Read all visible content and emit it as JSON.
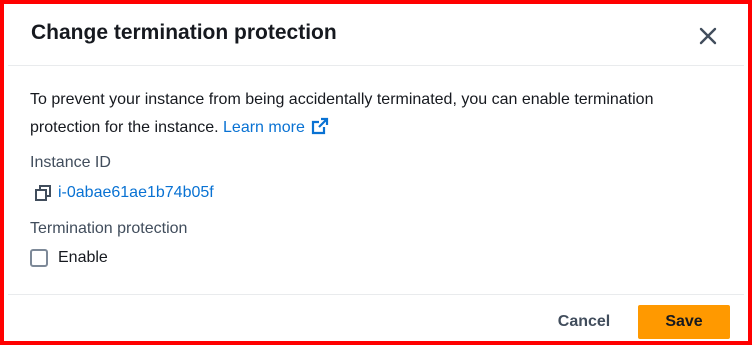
{
  "dialog": {
    "title": "Change termination protection",
    "close_icon": "close-icon"
  },
  "body": {
    "description": "To prevent your instance from being accidentally terminated, you can enable termination protection for the instance.",
    "learn_more": "Learn more",
    "learn_more_icon": "external-link-icon",
    "instance_id_label": "Instance ID",
    "instance_id": "i-0abae61ae1b74b05f",
    "copy_icon": "copy-icon",
    "termination_label": "Termination protection",
    "enable_label": "Enable",
    "enable_checked": false
  },
  "footer": {
    "cancel_label": "Cancel",
    "save_label": "Save"
  },
  "colors": {
    "link": "#0972d3",
    "primary_button": "#ff9900",
    "frame_border": "#ff0000"
  }
}
